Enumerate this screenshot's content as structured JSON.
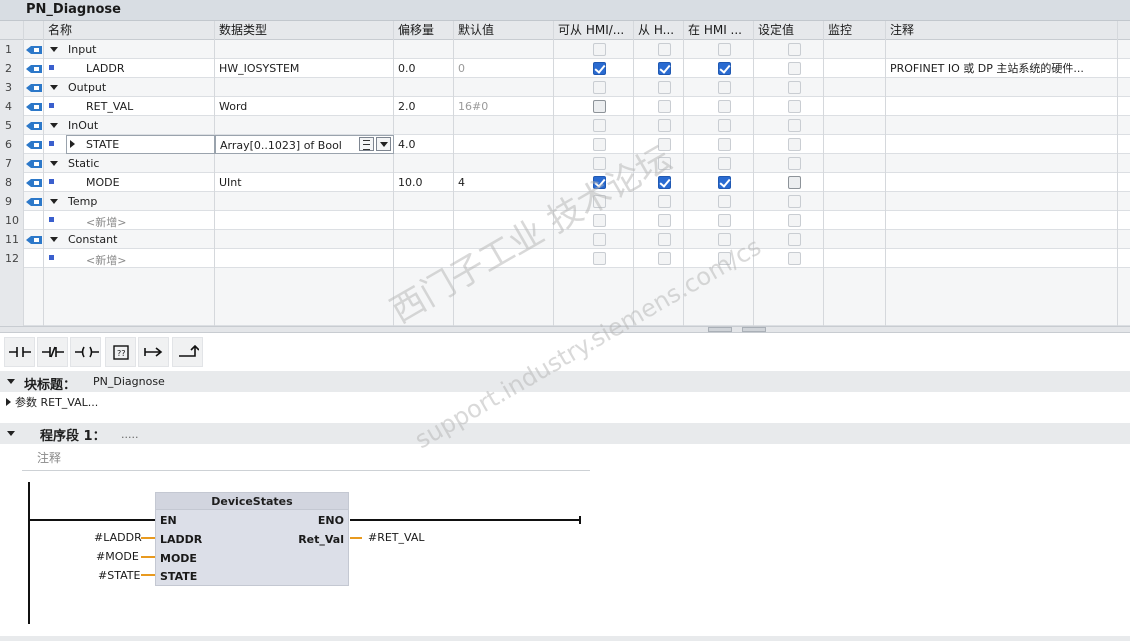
{
  "header": {
    "title": "PN_Diagnose"
  },
  "columns": [
    "名称",
    "数据类型",
    "偏移量",
    "默认值",
    "可从 HMI/...",
    "从 H...",
    "在 HMI ...",
    "设定值",
    "监控",
    "注释"
  ],
  "rows": [
    {
      "num": "1",
      "kind": "section",
      "name": "Input",
      "type": "",
      "offset": "",
      "default": "",
      "c1": false,
      "c2": false,
      "c3": false,
      "c4": false,
      "comment": ""
    },
    {
      "num": "2",
      "kind": "member",
      "name": "LADDR",
      "type": "HW_IOSYSTEM",
      "offset": "0.0",
      "default": "0",
      "c1": true,
      "c2": true,
      "c3": true,
      "c4": false,
      "comment": "PROFINET IO 或 DP 主站系统的硬件..."
    },
    {
      "num": "3",
      "kind": "section",
      "name": "Output",
      "type": "",
      "offset": "",
      "default": "",
      "c1": false,
      "c2": false,
      "c3": false,
      "c4": false,
      "comment": ""
    },
    {
      "num": "4",
      "kind": "member",
      "name": "RET_VAL",
      "type": "Word",
      "offset": "2.0",
      "default": "16#0",
      "c1": false,
      "c2": false,
      "c3": false,
      "c4": false,
      "comment": ""
    },
    {
      "num": "5",
      "kind": "section",
      "name": "InOut",
      "type": "",
      "offset": "",
      "default": "",
      "c1": false,
      "c2": false,
      "c3": false,
      "c4": false,
      "comment": ""
    },
    {
      "num": "6",
      "kind": "member-collapsed",
      "name": "STATE",
      "type": "Array[0..1023] of Bool",
      "offset": "4.0",
      "default": "",
      "c1": false,
      "c2": false,
      "c3": false,
      "c4": false,
      "comment": ""
    },
    {
      "num": "7",
      "kind": "section",
      "name": "Static",
      "type": "",
      "offset": "",
      "default": "",
      "c1": false,
      "c2": false,
      "c3": false,
      "c4": false,
      "comment": ""
    },
    {
      "num": "8",
      "kind": "member",
      "name": "MODE",
      "type": "UInt",
      "offset": "10.0",
      "default": "4",
      "c1": true,
      "c2": true,
      "c3": true,
      "c4": false,
      "comment": ""
    },
    {
      "num": "9",
      "kind": "section",
      "name": "Temp",
      "type": "",
      "offset": "",
      "default": "",
      "c1": false,
      "c2": false,
      "c3": false,
      "c4": false,
      "comment": ""
    },
    {
      "num": "10",
      "kind": "add",
      "name": "<新增>",
      "type": "",
      "offset": "",
      "default": "",
      "c1": false,
      "c2": false,
      "c3": false,
      "c4": false,
      "comment": ""
    },
    {
      "num": "11",
      "kind": "section",
      "name": "Constant",
      "type": "",
      "offset": "",
      "default": "",
      "c1": false,
      "c2": false,
      "c3": false,
      "c4": false,
      "comment": ""
    },
    {
      "num": "12",
      "kind": "add",
      "name": "<新增>",
      "type": "",
      "offset": "",
      "default": "",
      "c1": false,
      "c2": false,
      "c3": false,
      "c4": false,
      "comment": ""
    }
  ],
  "toolbar": {
    "buttons": [
      "contact-no-icon",
      "contact-nc-icon",
      "coil-icon",
      "empty-box-icon",
      "open-branch-icon",
      "close-branch-icon"
    ]
  },
  "block": {
    "title_label": "块标题：",
    "title_value": "PN_Diagnose",
    "comment": "参数 RET_VAL..."
  },
  "network": {
    "label": "程序段 1：",
    "title": ".....",
    "comment_placeholder": "注释"
  },
  "fb": {
    "name": "DeviceStates",
    "pins_in": [
      "EN",
      "LADDR",
      "MODE",
      "STATE"
    ],
    "pins_out": [
      "ENO",
      "Ret_Val"
    ],
    "params_in": [
      "#LADDR",
      "#MODE",
      "#STATE"
    ],
    "params_out": [
      "#RET_VAL"
    ]
  },
  "watermark": {
    "line1": "西门子工业 技术论坛",
    "line2": "support.industry.siemens.com/cs"
  },
  "colors": {
    "accent": "#2a6bd1",
    "wire": "#e89a1f",
    "section_icon": "#2c78c9"
  }
}
